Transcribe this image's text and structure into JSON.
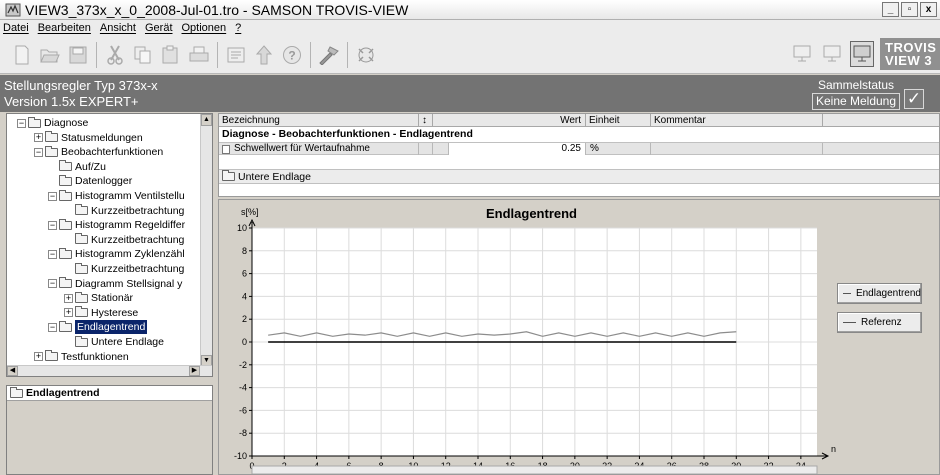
{
  "window": {
    "title": "VIEW3_373x_x_0_2008-Jul-01.tro - SAMSON TROVIS-VIEW",
    "controls": [
      "_",
      "▫",
      "x"
    ]
  },
  "menu": [
    "Datei",
    "Bearbeiten",
    "Ansicht",
    "Gerät",
    "Optionen",
    "?"
  ],
  "toolbar": {
    "buttons": [
      "new-icon",
      "open-icon",
      "save-icon",
      "cut-icon",
      "copy-icon",
      "paste-icon",
      "print-icon",
      "properties-icon",
      "upload-icon",
      "help-icon",
      "tools-icon",
      "device-icon"
    ],
    "right_buttons": [
      "monitor-icon",
      "monitor-offline-icon",
      "monitor-active-icon"
    ],
    "brand": "TROVIS VIEW 3"
  },
  "device": {
    "title": "Stellungsregler Typ 373x-x",
    "version": "Version 1.5x EXPERT+",
    "status_label": "Sammelstatus",
    "status_value": "Keine Meldung",
    "check": "✓"
  },
  "tree": {
    "items": [
      {
        "label": "Diagnose",
        "level": 1,
        "expander": "−"
      },
      {
        "label": "Statusmeldungen",
        "level": 2,
        "expander": "+"
      },
      {
        "label": "Beobachterfunktionen",
        "level": 2,
        "expander": "−"
      },
      {
        "label": "Auf/Zu",
        "level": 3,
        "expander": ""
      },
      {
        "label": "Datenlogger",
        "level": 3,
        "expander": ""
      },
      {
        "label": "Histogramm Ventilstellu",
        "level": 3,
        "expander": "−"
      },
      {
        "label": "Kurzzeitbetrachtung",
        "level": 4,
        "expander": ""
      },
      {
        "label": "Histogramm Regeldiffer",
        "level": 3,
        "expander": "−"
      },
      {
        "label": "Kurzzeitbetrachtung",
        "level": 4,
        "expander": ""
      },
      {
        "label": "Histogramm Zyklenzähl",
        "level": 3,
        "expander": "−"
      },
      {
        "label": "Kurzzeitbetrachtung",
        "level": 4,
        "expander": ""
      },
      {
        "label": "Diagramm Stellsignal y",
        "level": 3,
        "expander": "−"
      },
      {
        "label": "Stationär",
        "level": 4,
        "expander": "+"
      },
      {
        "label": "Hysterese",
        "level": 4,
        "expander": "+"
      },
      {
        "label": "Endlagentrend",
        "level": 3,
        "expander": "−",
        "selected": true
      },
      {
        "label": "Untere Endlage",
        "level": 4,
        "expander": ""
      },
      {
        "label": "Testfunktionen",
        "level": 2,
        "expander": "+"
      }
    ]
  },
  "info_panel": {
    "title": "Endlagentrend"
  },
  "grid": {
    "headers": {
      "name": "Bezeichnung",
      "sort": "↕",
      "value": "Wert",
      "unit": "Einheit",
      "comment": "Kommentar"
    },
    "group": "Diagnose - Beobachterfunktionen - Endlagentrend",
    "row": {
      "name": "Schwellwert für Wertaufnahme",
      "value": "0.25",
      "unit": "%"
    },
    "subfolder": "Untere Endlage"
  },
  "chart_data": {
    "type": "line",
    "title": "Endlagentrend",
    "ylabel": "s[%]",
    "xlabel": "n",
    "xlim": [
      0,
      35
    ],
    "ylim": [
      -10,
      10
    ],
    "xticks": [
      0,
      2,
      4,
      6,
      8,
      10,
      12,
      14,
      16,
      18,
      20,
      22,
      24,
      26,
      28,
      30,
      32,
      34
    ],
    "yticks": [
      10,
      8,
      6,
      4,
      2,
      0,
      -2,
      -4,
      -6,
      -8,
      -10
    ],
    "grid": true,
    "series": [
      {
        "name": "Endlagentrend",
        "color": "#8c8c8c",
        "x": [
          1,
          2,
          3,
          4,
          5,
          6,
          7,
          8,
          9,
          10,
          11,
          12,
          13,
          14,
          15,
          16,
          17,
          18,
          19,
          20,
          21,
          22,
          23,
          24,
          25,
          26,
          27,
          28,
          29,
          30
        ],
        "values": [
          0.6,
          0.8,
          0.5,
          0.8,
          0.5,
          0.7,
          0.6,
          0.8,
          0.5,
          0.8,
          0.5,
          0.8,
          0.5,
          0.7,
          0.6,
          0.7,
          0.9,
          0.5,
          0.8,
          0.5,
          0.8,
          0.5,
          0.8,
          0.5,
          0.8,
          0.5,
          0.8,
          0.5,
          0.8,
          0.9
        ]
      },
      {
        "name": "Referenz",
        "color": "#000000",
        "x": [
          1,
          30
        ],
        "values": [
          0,
          0
        ]
      }
    ],
    "legend": [
      "Endlagentrend",
      "Referenz"
    ],
    "legend_position": "right"
  }
}
